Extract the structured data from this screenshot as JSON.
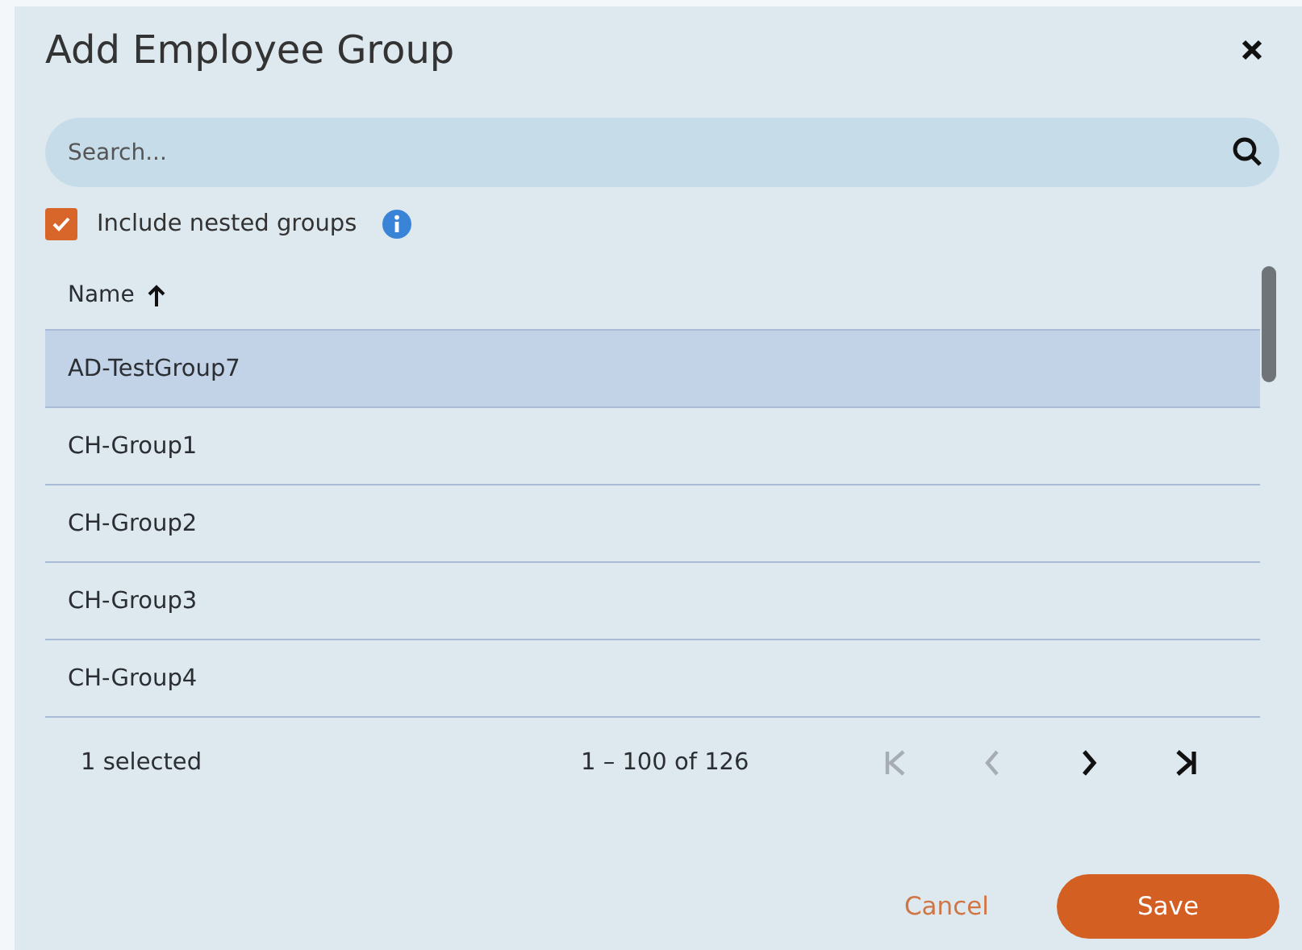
{
  "window": {
    "title": "Add Employee Group"
  },
  "search": {
    "placeholder": "Search..."
  },
  "include_nested": {
    "label": "Include nested groups",
    "checked": true
  },
  "table": {
    "columns": [
      {
        "label": "Name",
        "sort_ascending": true
      }
    ],
    "rows": [
      {
        "name": "AD-TestGroup7",
        "selected": true
      },
      {
        "name": "CH-Group1",
        "selected": false
      },
      {
        "name": "CH-Group2",
        "selected": false
      },
      {
        "name": "CH-Group3",
        "selected": false
      },
      {
        "name": "CH-Group4",
        "selected": false
      }
    ]
  },
  "paginator": {
    "selection": "1 selected",
    "range": "1 – 100 of 126",
    "buttons": [
      {
        "kind": "first",
        "disabled": true
      },
      {
        "kind": "previous",
        "disabled": true
      },
      {
        "kind": "next",
        "disabled": false
      },
      {
        "kind": "last",
        "disabled": false
      }
    ]
  },
  "buttons": [
    {
      "kind": "secondary",
      "label": "Cancel"
    },
    {
      "kind": "primary",
      "label": "Save"
    }
  ]
}
